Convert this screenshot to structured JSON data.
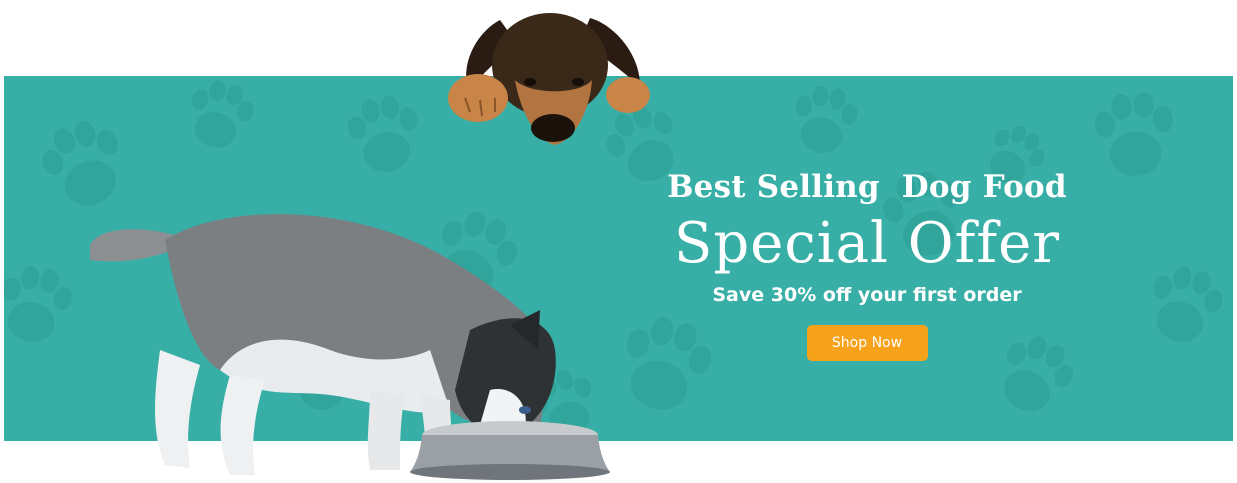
{
  "banner": {
    "background_color": "#37afa6",
    "paw_color": "#2e9d94",
    "headline": "Best Selling  Dog Food",
    "offer_title": "Special Offer",
    "subtitle": "Save 30% off your first order",
    "cta_label": "Shop Now",
    "cta_color": "#f7a21b"
  },
  "images": {
    "top_puppy": "german-shepherd-puppy-peeking-image",
    "main_dog": "husky-puppy-eating-from-bowl-image"
  }
}
